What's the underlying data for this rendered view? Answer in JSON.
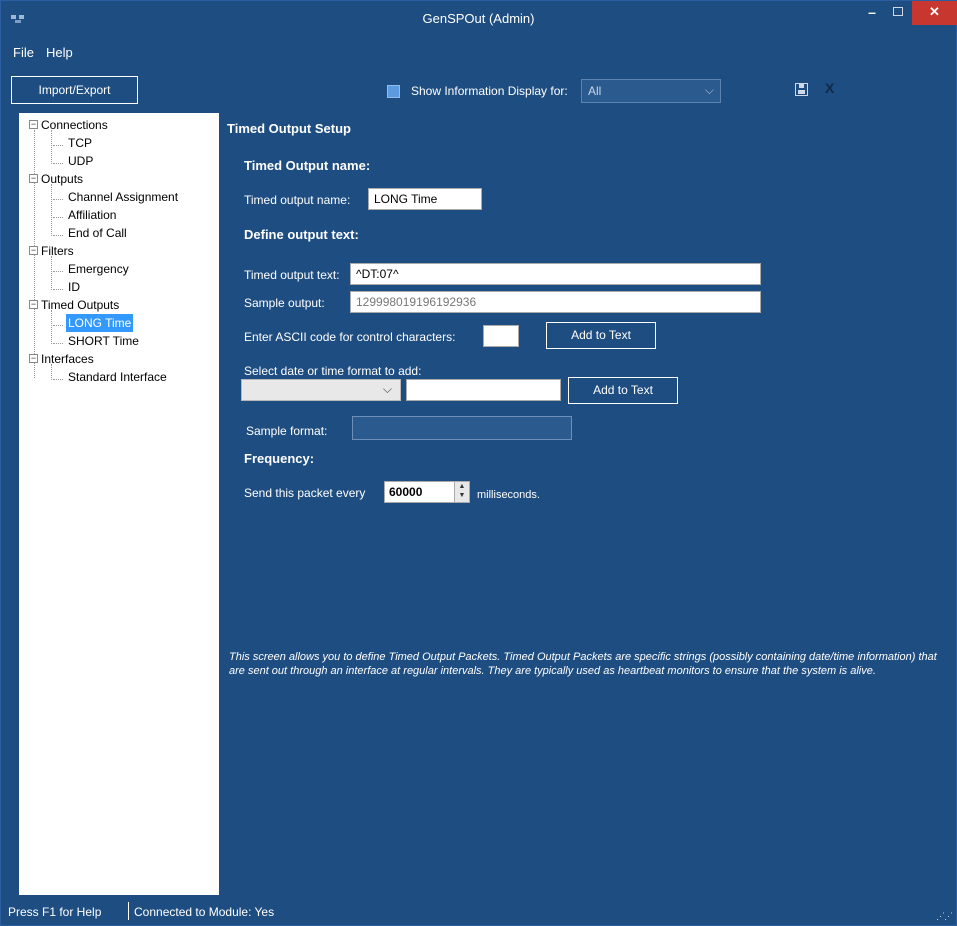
{
  "window": {
    "title": "GenSPOut (Admin)",
    "close": "✕",
    "minimize": "–"
  },
  "menu": {
    "file": "File",
    "help": "Help"
  },
  "toolbar": {
    "import_export": "Import/Export",
    "show_info_label": "Show Information Display for:",
    "show_info_select": "All",
    "close_label": "X"
  },
  "tree": {
    "connections": "Connections",
    "tcp": "TCP",
    "udp": "UDP",
    "outputs": "Outputs",
    "channel_assignment": "Channel Assignment",
    "affiliation": "Affiliation",
    "end_of_call": "End of Call",
    "filters": "Filters",
    "emergency": "Emergency",
    "id": "ID",
    "timed_outputs": "Timed Outputs",
    "long_time": "LONG Time",
    "short_time": "SHORT Time",
    "interfaces": "Interfaces",
    "standard_interface": "Standard Interface",
    "toggle_symbol": "−"
  },
  "form": {
    "page_title": "Timed Output Setup",
    "section_name": "Timed Output name:",
    "name_label": "Timed output name:",
    "name_value": "LONG Time",
    "section_text": "Define output text:",
    "text_label": "Timed output text:",
    "text_value": "^DT:07^",
    "sample_label": "Sample output:",
    "sample_value": "129998019196192936",
    "ascii_label": "Enter ASCII code for control characters:",
    "ascii_value": "",
    "add_to_text_1": "Add to Text",
    "date_format_label": "Select date or time format to add:",
    "date_format_value": "",
    "add_to_text_2": "Add to Text",
    "sample_format_label": "Sample format:",
    "sample_format_value": "",
    "section_frequency": "Frequency:",
    "send_every_label": "Send this packet every",
    "interval_value": "60000",
    "ms_label": "milliseconds.",
    "info_text": "This screen allows you to define Timed Output Packets.  Timed Output Packets are specific strings (possibly containing date/time information) that are sent out through an interface at regular intervals.  They are typically used as heartbeat monitors to ensure that the system is alive."
  },
  "status": {
    "help_hint": "Press F1 for Help",
    "connection": "Connected to Module: Yes"
  },
  "colors": {
    "background": "#1e4d82",
    "selection": "#3399ff",
    "close_button": "#c7372f"
  }
}
